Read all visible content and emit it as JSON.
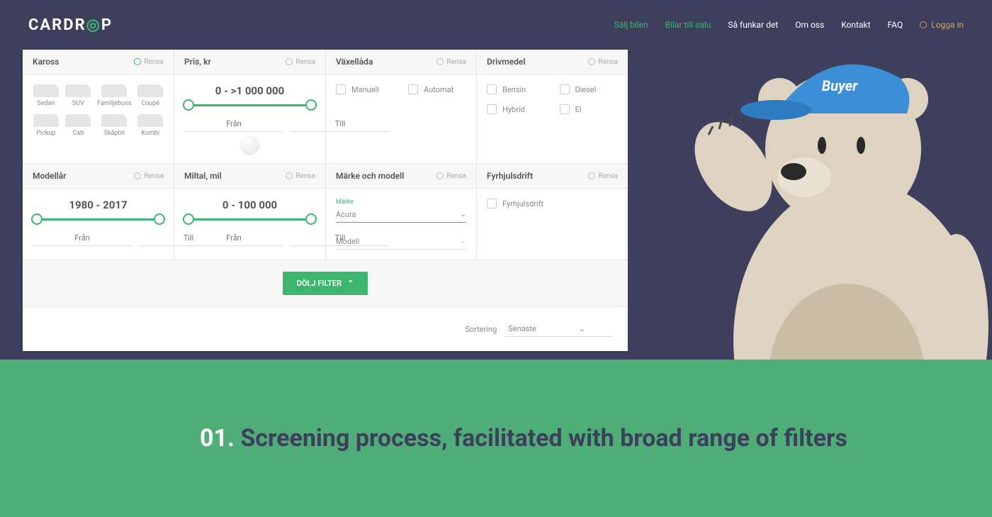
{
  "brand": {
    "text1": "CARDR",
    "text2": "P",
    "iconChar": "◎"
  },
  "nav": {
    "items": [
      {
        "label": "Sälj bilen",
        "active": true
      },
      {
        "label": "Bilar till salu",
        "active": true
      },
      {
        "label": "Så funkar det"
      },
      {
        "label": "Om oss"
      },
      {
        "label": "Kontakt"
      },
      {
        "label": "FAQ"
      }
    ],
    "login": "Logga in"
  },
  "filters": {
    "clear": "Rensa",
    "kaross": {
      "title": "Kaross",
      "types": [
        "Sedan",
        "SUV",
        "Familjebuss",
        "Coupé",
        "Pickup",
        "Cab",
        "Skåpbil",
        "Kombi"
      ]
    },
    "pris": {
      "title": "Pris, kr",
      "value": "0 - >1 000 000",
      "from": "Från",
      "to": "Till"
    },
    "vaxellada": {
      "title": "Växellåda",
      "options": [
        "Manuell",
        "Automat"
      ]
    },
    "drivmedel": {
      "title": "Drivmedel",
      "options": [
        "Bensin",
        "Diesel",
        "Hybrid",
        "El"
      ]
    },
    "modellar": {
      "title": "Modellår",
      "value": "1980 - 2017",
      "from": "Från",
      "to": "Till"
    },
    "miltal": {
      "title": "Miltal, mil",
      "value": "0 - 100 000",
      "from": "Från",
      "to": "Till"
    },
    "marke": {
      "title": "Märke och modell",
      "label": "Märke",
      "selected": "Acura",
      "model_placeholder": "Modell"
    },
    "fyrhjul": {
      "title": "Fyrhjulsdrift",
      "option": "Fyrhjulsdrift"
    },
    "hide_button": "DÖLJ FILTER"
  },
  "sort": {
    "label": "Sortering",
    "selected": "Senaste"
  },
  "caption": {
    "num": "01.",
    "text": "Screening process, facilitated with broad range of filters"
  },
  "bear": {
    "cap_text": "Buyer"
  }
}
